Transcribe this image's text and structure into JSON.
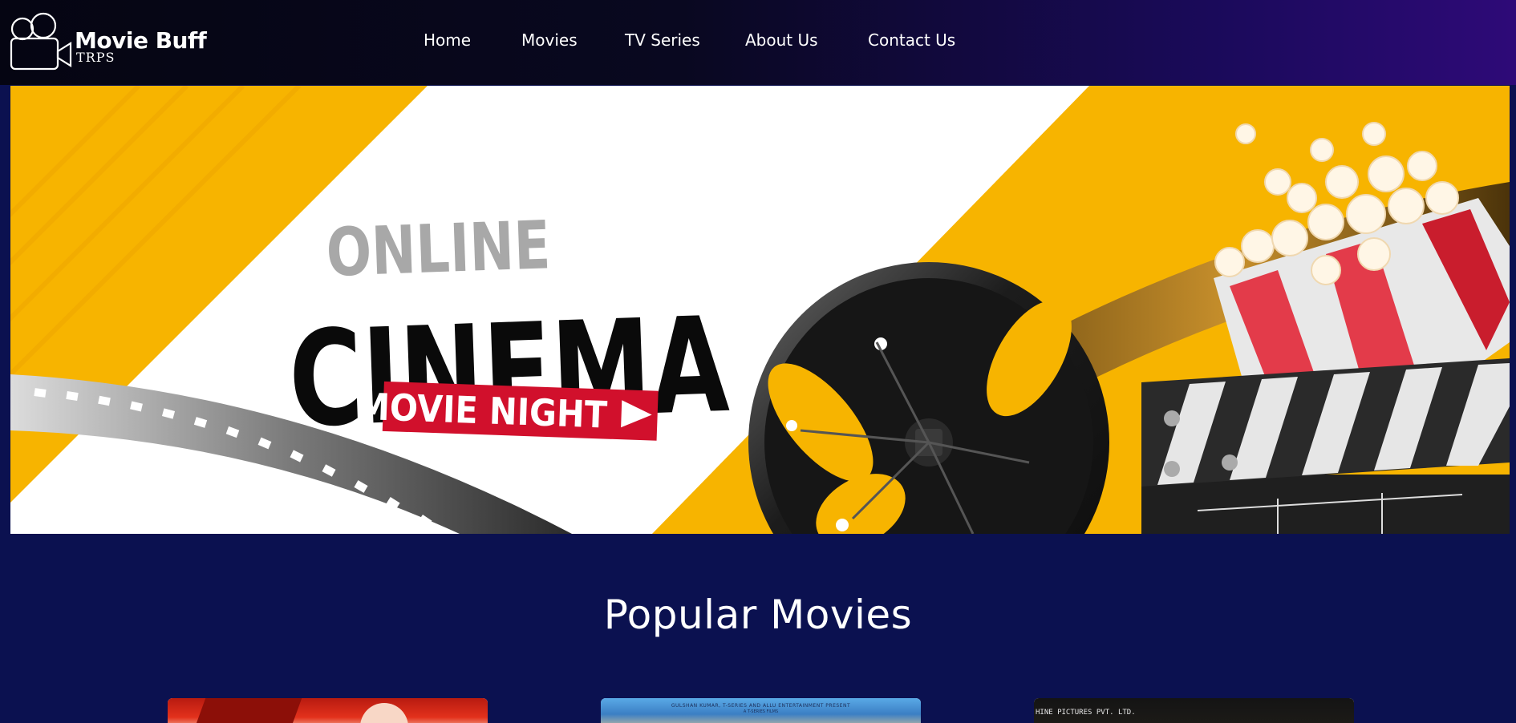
{
  "brand": {
    "title": "Movie Buff",
    "subtitle": "TRPS",
    "icon": "movie-camera-icon"
  },
  "nav": {
    "items": [
      {
        "label": "Home"
      },
      {
        "label": "Movies"
      },
      {
        "label": "TV Series"
      },
      {
        "label": "About Us"
      },
      {
        "label": "Contact Us"
      }
    ]
  },
  "hero": {
    "line1": "ONLINE",
    "line2": "CINEMA",
    "badge": "MOVIE NIGHT",
    "colors": {
      "accent": "#f7b400",
      "badge": "#d1102c"
    }
  },
  "popular": {
    "title": "Popular Movies",
    "cards": [
      {
        "caption": ""
      },
      {
        "caption": "GULSHAN KUMAR, T-SERIES AND ALLU ENTERTAINMENT PRESENT",
        "caption2": "A T-SERIES FILMS"
      },
      {
        "caption": "HINE PICTURES PVT. LTD."
      }
    ]
  },
  "colors": {
    "page_bg": "#0b1150",
    "nav_gradient_end": "#2e0a78"
  }
}
